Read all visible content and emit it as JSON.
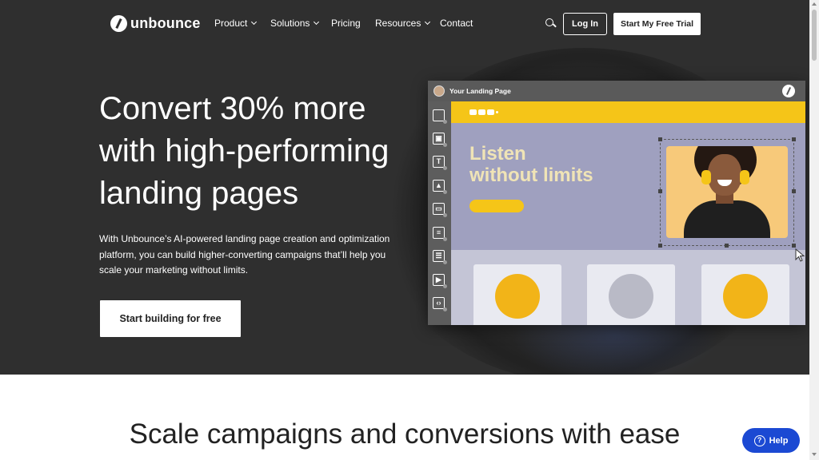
{
  "brand": {
    "name": "unbounce"
  },
  "nav": {
    "items": [
      {
        "label": "Product",
        "dropdown": true
      },
      {
        "label": "Solutions",
        "dropdown": true
      },
      {
        "label": "Pricing",
        "dropdown": false
      },
      {
        "label": "Resources",
        "dropdown": true
      },
      {
        "label": "Contact",
        "dropdown": false
      }
    ],
    "login_label": "Log In",
    "trial_label": "Start My Free Trial"
  },
  "hero": {
    "title": "Convert 30% more with high-performing landing pages",
    "subtitle": "With Unbounce’s AI-powered landing page creation and optimization platform, you can build higher-converting campaigns that’ll help you scale your marketing without limits.",
    "cta_label": "Start building for free"
  },
  "builder": {
    "title": "Your Landing Page",
    "headline_line1": "Listen",
    "headline_line2": "without limits",
    "tools": [
      "section-icon",
      "image-box-icon",
      "text-icon",
      "image-icon",
      "button-icon",
      "form-icon",
      "list-icon",
      "video-icon",
      "code-icon"
    ]
  },
  "section": {
    "title": "Scale campaigns and conversions with ease"
  },
  "help": {
    "label": "Help"
  },
  "colors": {
    "hero_bg": "#2f2f2f",
    "accent_yellow": "#f5c518",
    "help_blue": "#1b49d3",
    "canvas_purple": "#9fa0bf"
  }
}
